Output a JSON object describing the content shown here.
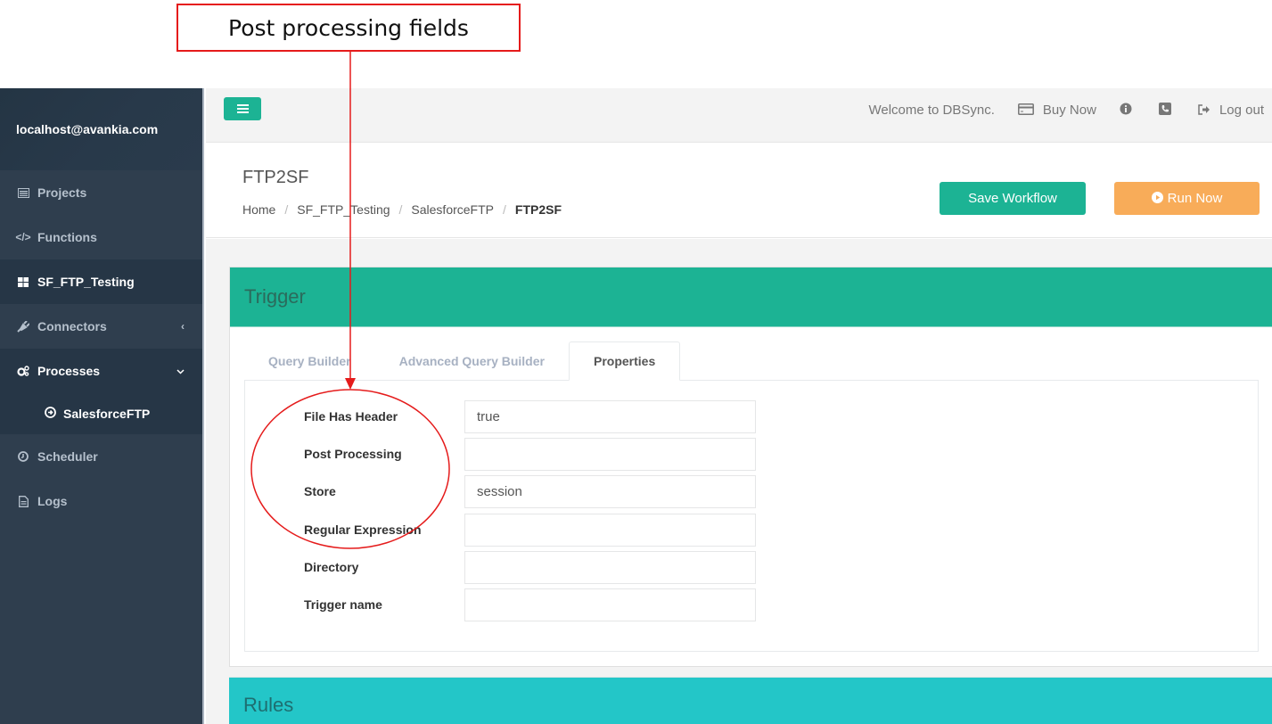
{
  "annotation": {
    "label": "Post processing fields",
    "color": "#e51b1b"
  },
  "sidebar": {
    "user": "localhost@avankia.com",
    "items": [
      {
        "label": "Projects",
        "icon": "list-alt-icon"
      },
      {
        "label": "Functions",
        "icon": "code-icon"
      },
      {
        "label": "SF_FTP_Testing",
        "icon": "th-large-icon",
        "active": true
      },
      {
        "label": "Connectors",
        "icon": "plug-icon",
        "chevron": "‹"
      },
      {
        "label": "Processes",
        "icon": "cogs-icon",
        "chevron": "⌄"
      },
      {
        "label": "Scheduler",
        "icon": "clock-icon"
      },
      {
        "label": "Logs",
        "icon": "file-text-icon"
      }
    ],
    "sub_items": [
      {
        "label": "SalesforceFTP",
        "icon": "arrow-circle-right-icon"
      }
    ]
  },
  "topbar": {
    "welcome": "Welcome to DBSync.",
    "buy_now": "Buy Now",
    "log_out": "Log out"
  },
  "header": {
    "title": "FTP2SF",
    "breadcrumb": [
      "Home",
      "SF_FTP_Testing",
      "SalesforceFTP",
      "FTP2SF"
    ],
    "save_label": "Save Workflow",
    "run_label": "Run Now"
  },
  "trigger_panel": {
    "title": "Trigger",
    "tabs": [
      {
        "label": "Query Builder"
      },
      {
        "label": "Advanced Query Builder"
      },
      {
        "label": "Properties",
        "active": true
      }
    ],
    "fields": [
      {
        "label": "File Has Header",
        "value": "true"
      },
      {
        "label": "Post Processing",
        "value": ""
      },
      {
        "label": "Store",
        "value": "session"
      },
      {
        "label": "Regular Expression",
        "value": ""
      },
      {
        "label": "Directory",
        "value": ""
      },
      {
        "label": "Trigger name",
        "value": ""
      }
    ]
  },
  "rules_panel": {
    "title": "Rules"
  },
  "colors": {
    "brand_green": "#1cb394",
    "run_orange": "#f8ac59",
    "rules_cyan": "#23c6c8",
    "sidebar_bg": "#2f3e4e"
  }
}
